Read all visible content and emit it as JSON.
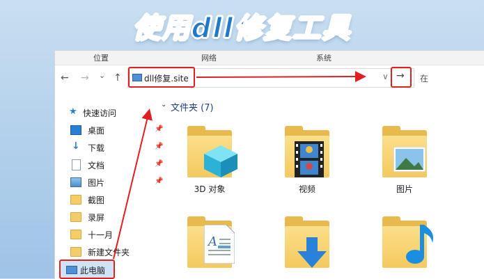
{
  "banner": {
    "title": "使用dll修复工具"
  },
  "ribbon": {
    "tabs": [
      "位置",
      "网络",
      "系统"
    ]
  },
  "navigation": {
    "back": "←",
    "forward": "→",
    "recent": "⌄",
    "up": "↑",
    "address_value": "dll修复.site",
    "dropdown": "∨",
    "go": "→",
    "search_cut": "在"
  },
  "sidebar": {
    "quick_access": "快速访问",
    "items": [
      {
        "label": "桌面",
        "icon": "desktop-icon",
        "pinned": true
      },
      {
        "label": "下载",
        "icon": "download-icon",
        "pinned": true
      },
      {
        "label": "文档",
        "icon": "document-icon",
        "pinned": true
      },
      {
        "label": "图片",
        "icon": "picture-icon",
        "pinned": true
      },
      {
        "label": "截图",
        "icon": "folder-icon",
        "pinned": false
      },
      {
        "label": "录屏",
        "icon": "folder-icon",
        "pinned": false
      },
      {
        "label": "十一月",
        "icon": "folder-icon",
        "pinned": false
      },
      {
        "label": "新建文件夹",
        "icon": "folder-icon",
        "pinned": false
      }
    ],
    "this_pc": "此电脑"
  },
  "content": {
    "group_header": "文件夹 (7)",
    "folders": [
      {
        "label": "3D 对象",
        "icon": "3d-objects-folder-icon"
      },
      {
        "label": "视频",
        "icon": "videos-folder-icon"
      },
      {
        "label": "图片",
        "icon": "pictures-folder-icon"
      },
      {
        "label": "",
        "icon": "documents-folder-icon"
      },
      {
        "label": "",
        "icon": "downloads-folder-icon"
      },
      {
        "label": "",
        "icon": "music-folder-icon"
      }
    ]
  },
  "colors": {
    "title_blue": "#1f78c8",
    "annotation_red": "#e02020",
    "folder_yellow": "#f4c95f"
  }
}
